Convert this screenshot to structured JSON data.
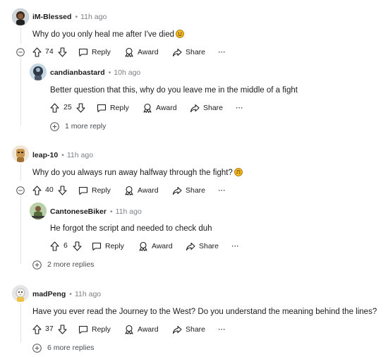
{
  "comments": [
    {
      "author": "iM-Blessed",
      "time": "11h ago",
      "text": "Why do you only heal me after I've died",
      "emoji": "slightly-smiling-face",
      "votes": "74",
      "reply": {
        "author": "candianbastard",
        "time": "10h ago",
        "text": "Better question that this, why do you leave me in the middle of a fight",
        "votes": "25"
      },
      "more": "1 more reply"
    },
    {
      "author": "leap-10",
      "time": "11h ago",
      "text": "Why do you always run away halfway through the fight?",
      "emoji": "upside-down-face",
      "votes": "40",
      "reply": {
        "author": "CantoneseBiker",
        "time": "11h ago",
        "text": "He forgot the script and needed to check duh",
        "votes": "6"
      },
      "more": "2 more replies"
    },
    {
      "author": "madPeng",
      "time": "11h ago",
      "text": "Have you ever read the Journey to the West? Do you understand the meaning behind the lines?",
      "votes": "37",
      "more": "6 more replies"
    }
  ],
  "actions": {
    "reply": "Reply",
    "award": "Award",
    "share": "Share",
    "more": "⋯"
  },
  "colors": {
    "accent": "#0079d3",
    "muted": "#7c7f83",
    "line": "#e2e4e6",
    "emoji": "#f5b921"
  }
}
